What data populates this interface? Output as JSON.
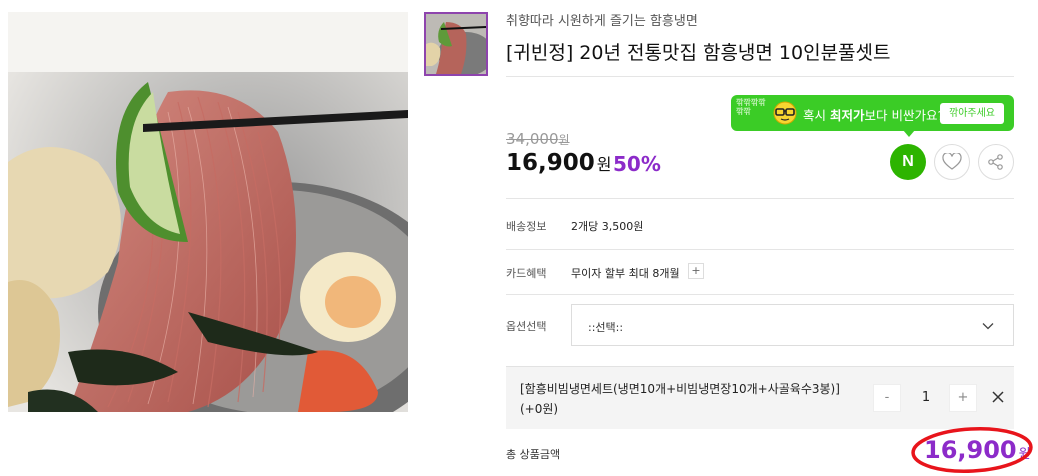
{
  "product": {
    "subtitle": "취향따라 시원하게 즐기는 함흥냉면",
    "title": "[귀빈정] 20년 전통맛집 함흥냉면 10인분풀셋트",
    "original_price": "34,000",
    "original_price_unit": "원",
    "price": "16,900",
    "price_unit": "원",
    "discount": "50%"
  },
  "promo": {
    "logo": "깎깎깎깎깎깎",
    "text_prefix": "혹시 ",
    "text_bold": "최저가",
    "text_suffix": "보다 비싼가요?",
    "button_label": "깎아주세요"
  },
  "actions": {
    "npay_label": "N"
  },
  "info": {
    "shipping_label": "배송정보",
    "shipping_value": "2개당 3,500원",
    "card_label": "카드혜택",
    "card_value": "무이자 할부 최대 8개월",
    "card_plus": "+",
    "option_label": "옵션선택",
    "option_placeholder": "::선택::"
  },
  "selected_option": {
    "name": "[함흥비빔냉면세트(냉면10개+비빔냉면장10개+사골육수3봉)] (+0원)",
    "qty_minus": "-",
    "quantity": "1",
    "qty_plus": "+"
  },
  "total": {
    "label": "총 상품금액",
    "amount": "16,900",
    "unit": "원"
  },
  "colors": {
    "accent_purple": "#8c2bc9",
    "promo_green": "#3bcc26",
    "npay_green": "#2db400",
    "highlight_red": "#e8141b"
  }
}
